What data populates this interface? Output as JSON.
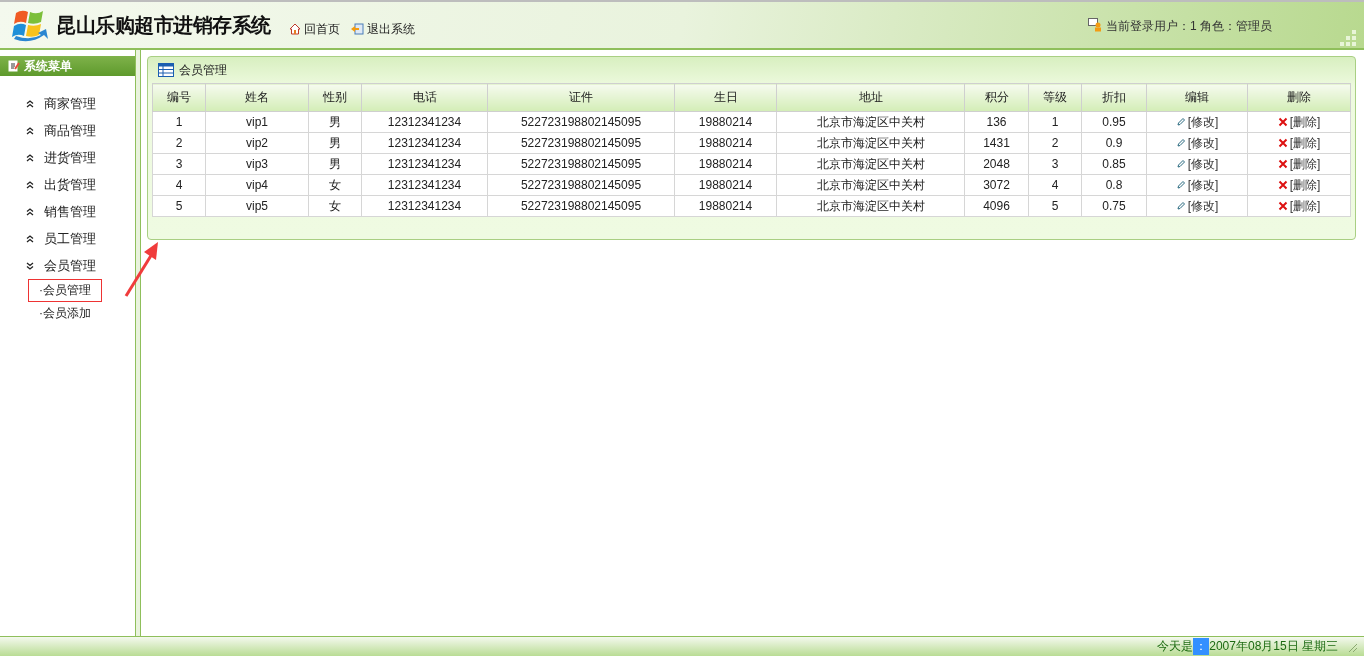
{
  "header": {
    "title": "昆山乐购超市进销存系统",
    "nav": [
      {
        "kind": "home",
        "label": "回首页"
      },
      {
        "kind": "exit",
        "label": "退出系统"
      }
    ],
    "user_info": "当前登录用户：1 角色：管理员"
  },
  "sidebar": {
    "title": "系统菜单",
    "items": [
      {
        "label": "商家管理",
        "expanded": false
      },
      {
        "label": "商品管理",
        "expanded": false
      },
      {
        "label": "进货管理",
        "expanded": false
      },
      {
        "label": "出货管理",
        "expanded": false
      },
      {
        "label": "销售管理",
        "expanded": false
      },
      {
        "label": "员工管理",
        "expanded": false
      },
      {
        "label": "会员管理",
        "expanded": true,
        "children": [
          {
            "label": "·会员管理",
            "selected": true
          },
          {
            "label": "·会员添加",
            "selected": false
          }
        ]
      }
    ]
  },
  "panel": {
    "title": "会员管理",
    "table": {
      "columns": [
        "编号",
        "姓名",
        "性别",
        "电话",
        "证件",
        "生日",
        "地址",
        "积分",
        "等级",
        "折扣",
        "编辑",
        "删除"
      ],
      "rows": [
        {
          "cells": [
            "1",
            "vip1",
            "男",
            "12312341234",
            "522723198802145095",
            "19880214",
            "北京市海淀区中关村",
            "136",
            "1",
            "0.95"
          ],
          "edit": "[修改]",
          "delete": "[删除]"
        },
        {
          "cells": [
            "2",
            "vip2",
            "男",
            "12312341234",
            "522723198802145095",
            "19880214",
            "北京市海淀区中关村",
            "1431",
            "2",
            "0.9"
          ],
          "edit": "[修改]",
          "delete": "[删除]"
        },
        {
          "cells": [
            "3",
            "vip3",
            "男",
            "12312341234",
            "522723198802145095",
            "19880214",
            "北京市海淀区中关村",
            "2048",
            "3",
            "0.85"
          ],
          "edit": "[修改]",
          "delete": "[删除]"
        },
        {
          "cells": [
            "4",
            "vip4",
            "女",
            "12312341234",
            "522723198802145095",
            "19880214",
            "北京市海淀区中关村",
            "3072",
            "4",
            "0.8"
          ],
          "edit": "[修改]",
          "delete": "[删除]"
        },
        {
          "cells": [
            "5",
            "vip5",
            "女",
            "12312341234",
            "522723198802145095",
            "19880214",
            "北京市海淀区中关村",
            "4096",
            "5",
            "0.75"
          ],
          "edit": "[修改]",
          "delete": "[删除]"
        }
      ]
    }
  },
  "status_bar": {
    "label": "今天是",
    "separator": "：",
    "date": "2007年08月15日 星期三"
  }
}
